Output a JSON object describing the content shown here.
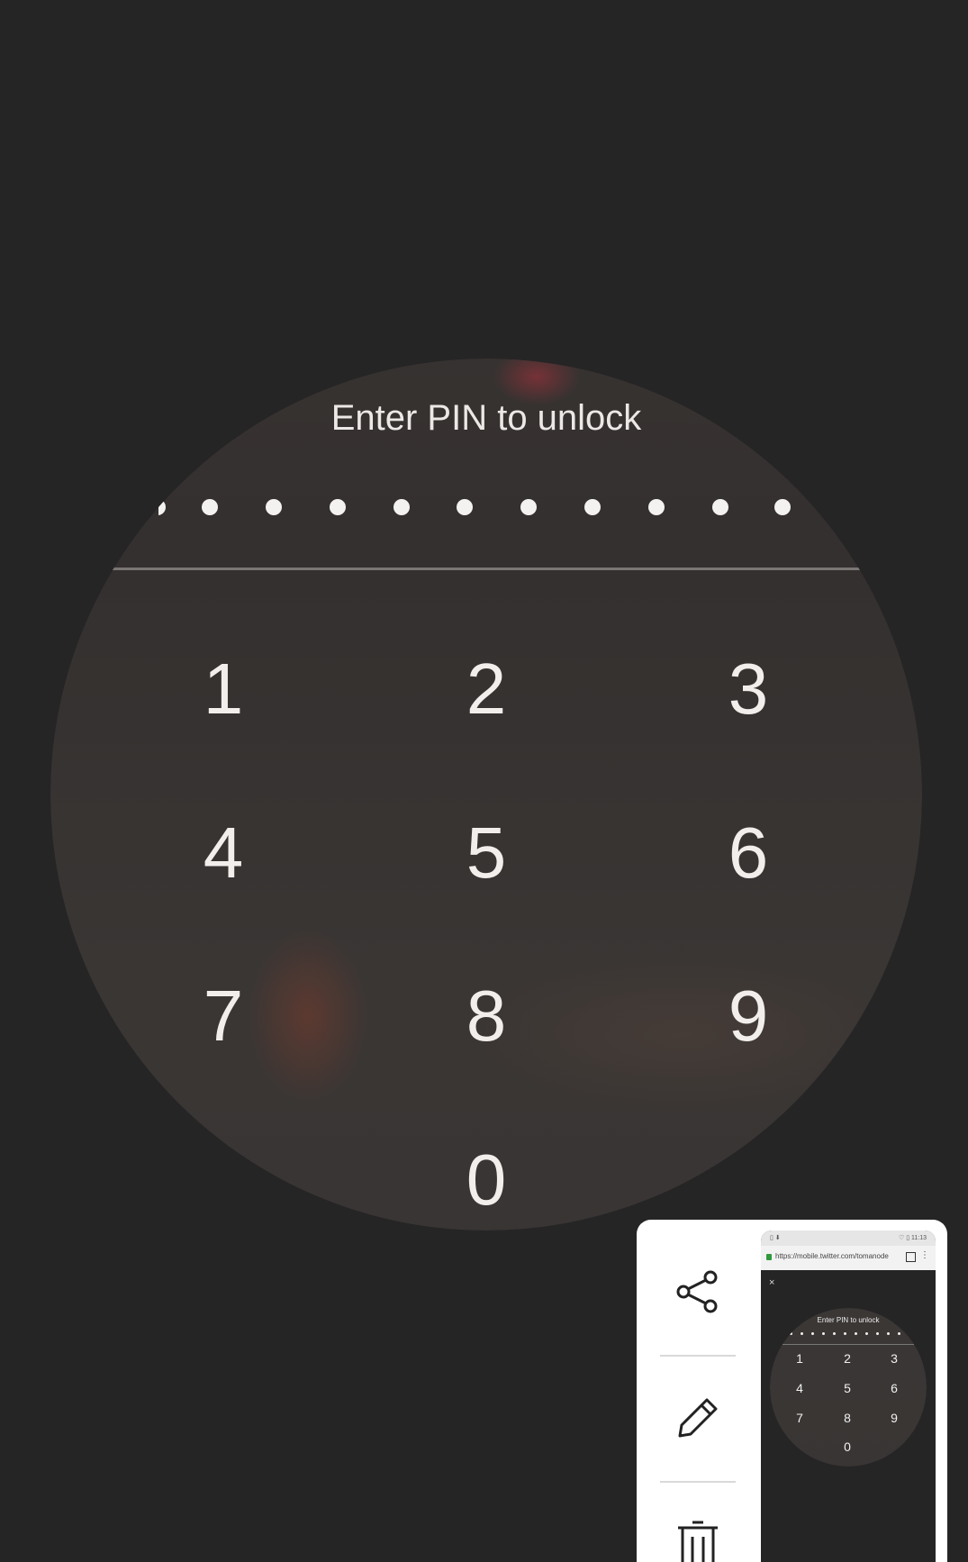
{
  "lock": {
    "title": "Enter PIN to unlock",
    "keys": [
      "1",
      "2",
      "3",
      "4",
      "5",
      "6",
      "7",
      "8",
      "9",
      "0"
    ]
  },
  "preview": {
    "status_left": "▯ ⬇",
    "status_right": "♡ ▯ 11:13",
    "url": "https://mobile.twitter.com/tomanode",
    "close": "×",
    "title": "Enter PIN to unlock",
    "keys": [
      "1",
      "2",
      "3",
      "4",
      "5",
      "6",
      "7",
      "8",
      "9",
      "0"
    ]
  },
  "actions": {
    "share_icon": "share-icon",
    "edit_icon": "pencil-icon",
    "delete_icon": "trash-icon"
  }
}
